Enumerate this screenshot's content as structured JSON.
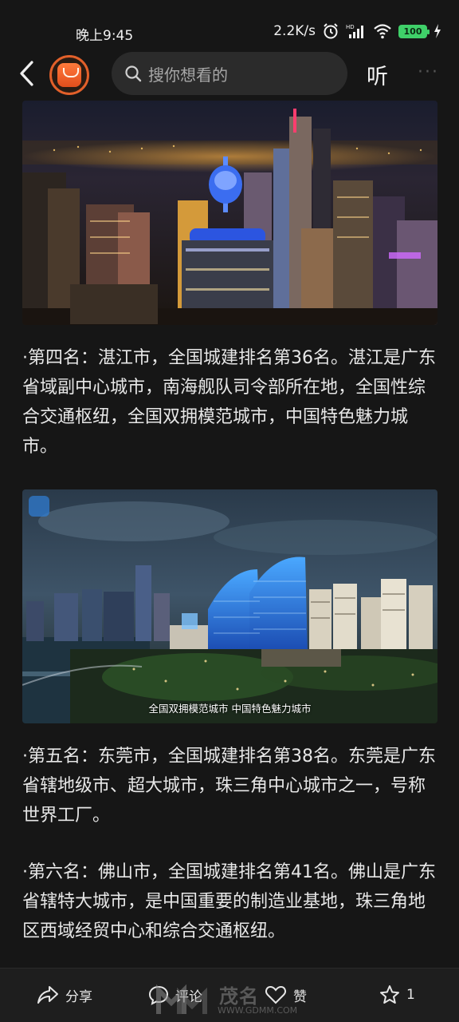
{
  "status": {
    "time": "晚上9:45",
    "net_speed": "2.2K/s",
    "battery": "100"
  },
  "header": {
    "search_placeholder": "搜你想看的",
    "listen_label": "听"
  },
  "article": {
    "photo1": {
      "description_icon": "city-night-photo"
    },
    "para_rank4": "·第四名：湛江市，全国城建排名第36名。湛江是广东省域副中心城市，南海舰队司令部所在地，全国性综合交通枢纽，全国双拥模范城市，中国特色魅力城市。",
    "photo2": {
      "caption": "全国双拥模范城市 中国特色魅力城市"
    },
    "para_rank5": "·第五名：东莞市，全国城建排名第38名。东莞是广东省辖地级市、超大城市，珠三角中心城市之一，号称世界工厂。",
    "para_rank6": "·第六名：佛山市，全国城建排名第41名。佛山是广东省辖特大城市，是中国重要的制造业基地，珠三角地区西域经贸中心和综合交通枢纽。"
  },
  "bottom_bar": {
    "share_label": "分享",
    "comment_label": "评论",
    "like_label": "赞",
    "favorite_count": "1"
  },
  "watermark": {
    "text": "茂名",
    "url": "WWW.GDMM.COM"
  },
  "colors": {
    "accent": "#e2602a",
    "battery": "#3fd069",
    "background": "#161616"
  }
}
